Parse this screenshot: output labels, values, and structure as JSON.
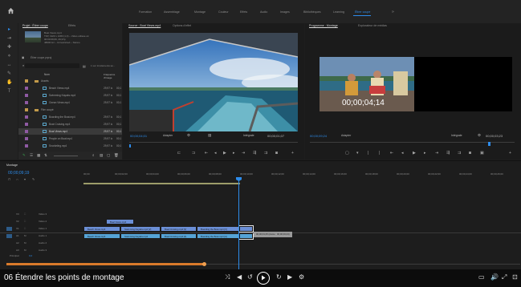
{
  "menu": {
    "items": [
      "Formation",
      "Assemblage",
      "Montage",
      "Couleur",
      "Effets",
      "Audio",
      "Images",
      "Bibliothèques",
      "Learning",
      "Étirer coupe"
    ],
    "active_index": 9
  },
  "project": {
    "tab_label": "Projet : Étirer coupe",
    "tab_other": "Effets",
    "info": [
      "Boat Views.mp4",
      "TFP, 1920 x 1080 (1,0) – Vidéo utilisée ok",
      "00:00:09;06, 29,97p",
      "48000 Hz – Unrestricted – Stéréo"
    ],
    "search_hint": "Étirer coupe.prproj",
    "count_label": "1 sur 14 éléments sé...",
    "columns": {
      "name": "Nom",
      "fps": "Fréquence d'image",
      "dur": "Début"
    },
    "rows": [
      {
        "kind": "folder",
        "name": "Assets",
        "fps": "",
        "dur": "",
        "swatch": "#c29a4a",
        "indent": 1
      },
      {
        "kind": "clip",
        "name": "Beach Views.mp4",
        "fps": "29,97 ic",
        "dur": "00;1",
        "swatch": "#8f5aa3",
        "indent": 2
      },
      {
        "kind": "clip",
        "name": "Swimming Kayaks.mp4",
        "fps": "29,97 ic",
        "dur": "00;1",
        "swatch": "#8f5aa3",
        "indent": 2
      },
      {
        "kind": "clip",
        "name": "Ocean Views.mp4",
        "fps": "29,97 ic",
        "dur": "00;1",
        "swatch": "#8f5aa3",
        "indent": 2
      },
      {
        "kind": "folder",
        "name": "Film coupé",
        "fps": "",
        "dur": "",
        "swatch": "#c29a4a",
        "indent": 1
      },
      {
        "kind": "clip",
        "name": "Boarding the Boat.mp4",
        "fps": "29,97 ic",
        "dur": "00;1",
        "swatch": "#8f5aa3",
        "indent": 2
      },
      {
        "kind": "clip",
        "name": "Boat Cruising.mp4",
        "fps": "29,97 ic",
        "dur": "00;1",
        "swatch": "#8f5aa3",
        "indent": 2
      },
      {
        "kind": "clip",
        "name": "Boat Views.mp4",
        "fps": "29,97 ic",
        "dur": "00;1",
        "swatch": "#8f5aa3",
        "indent": 2,
        "selected": true
      },
      {
        "kind": "clip",
        "name": "People on Boat.mp4",
        "fps": "29,97 ic",
        "dur": "00;1",
        "swatch": "#8f5aa3",
        "indent": 2
      },
      {
        "kind": "clip",
        "name": "Snorkeling.mp4",
        "fps": "29,97 ic",
        "dur": "00;1",
        "swatch": "#8f5aa3",
        "indent": 2
      }
    ]
  },
  "source": {
    "tab_label": "Source : Boat Views.mp4",
    "tab_other": "Options d'effet",
    "timecode": "00;00;04;01",
    "fit_label": "Adapter",
    "full_label": "Intégrale",
    "duration": "00;00;01;07"
  },
  "program": {
    "tab_label": "Programme : Montage",
    "tab_other": "Explorateur de médias",
    "timecode": "00;00;09;24",
    "overlay_timecode": "00;00;04;14",
    "fit_label": "Adapter",
    "full_label": "Intégrale",
    "duration": "00;00;03;23"
  },
  "timeline": {
    "tab_label": "Montage",
    "timecode": "00;00;09;19",
    "ruler": [
      "00;00",
      "00;00;02;00",
      "00;00;04;00",
      "00;00;06;00",
      "00;00;08;00",
      "00;00;10;00",
      "00;00;12;00",
      "00;00;14;00",
      "00;00;16;00",
      "00;00;18;00",
      "00;00;20;00",
      "00;00;22;00",
      "00;00;24;00",
      "00;00;26;00"
    ],
    "tracks": [
      {
        "label": "Vidéo 3",
        "kind": "v"
      },
      {
        "label": "Vidéo 2",
        "kind": "v"
      },
      {
        "label": "Vidéo 1",
        "kind": "v"
      },
      {
        "label": "Audio 1",
        "kind": "a"
      },
      {
        "label": "Audio 2",
        "kind": "a"
      },
      {
        "label": "Audio 3",
        "kind": "a"
      }
    ],
    "track_ids": [
      "V3",
      "V2",
      "V1",
      "A1",
      "A2",
      "A3"
    ],
    "master_label": "Principal",
    "master_value": "0,0",
    "clips": {
      "v2": [
        "Boat Views.mp4"
      ],
      "v1": [
        "Beach Views.mp4",
        "Swimming Kayaks.mp4 [V]",
        "Boat Cruising.mp4 [V]",
        "Boarding the Boat.mp4 [V]",
        ""
      ],
      "a1": [
        "Beach Views.mp4",
        "Swimming Kayaks.mp4",
        "Boat Cruising.mp4 [A]",
        "Boarding the Boat.mp4 [A]",
        ""
      ]
    },
    "tooltip": "00;00;01;25 (durée : 00;00;03;23)"
  },
  "player": {
    "title": "06 Étendre les points de montage"
  },
  "colors": {
    "accent": "#2d8ceb",
    "video_clip": "#6b8fd6",
    "audio_clip": "#55a3d6",
    "project_swatch": "#8f5aa3",
    "folder": "#c29a4a"
  },
  "icons": [
    "home-icon",
    "select-tool-icon",
    "ripple-edit-icon",
    "razor-icon",
    "slip-icon",
    "pen-icon",
    "hand-icon",
    "type-icon",
    "play-icon",
    "skip-back-icon",
    "skip-forward-icon",
    "captions-icon",
    "volume-icon",
    "fullscreen-icon",
    "settings-icon"
  ]
}
